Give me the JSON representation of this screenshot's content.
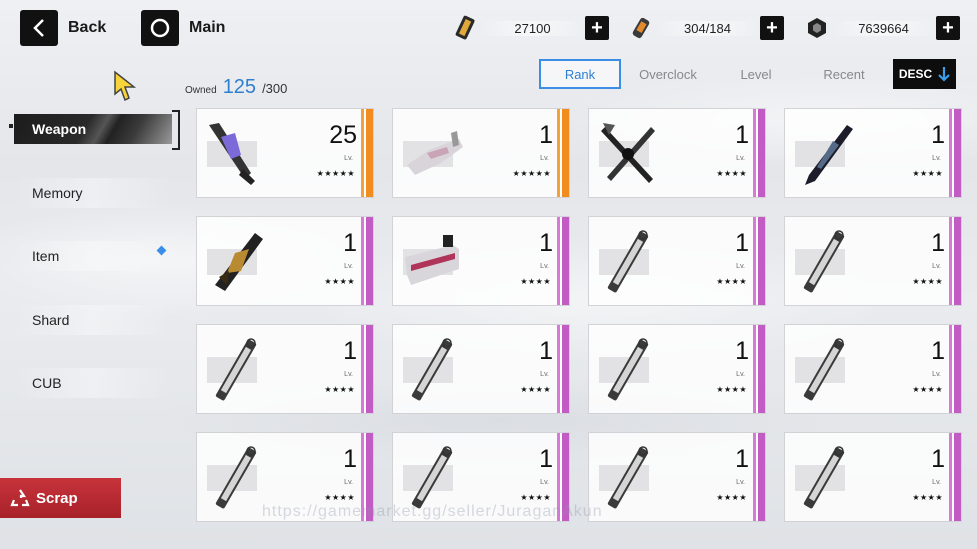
{
  "nav": {
    "back_label": "Back",
    "main_label": "Main"
  },
  "resources": [
    {
      "icon": "gold-ingot-icon",
      "value": "27100"
    },
    {
      "icon": "battery-icon",
      "value": "304/184"
    },
    {
      "icon": "gem-icon",
      "value": "7639664"
    }
  ],
  "sidebar": {
    "items": [
      {
        "label": "Weapon",
        "active": true
      },
      {
        "label": "Memory"
      },
      {
        "label": "Item",
        "notification": true
      },
      {
        "label": "Shard"
      },
      {
        "label": "CUB"
      }
    ],
    "scrap_label": "Scrap"
  },
  "inventory": {
    "owned_label": "Owned",
    "owned_count": "125",
    "owned_max": "/300"
  },
  "sort": {
    "tabs": [
      "Rank",
      "Overclock",
      "Level",
      "Recent"
    ],
    "active_tab": "Rank",
    "order_label": "DESC"
  },
  "weapons": [
    {
      "level": "25",
      "lv_label": "Lv.",
      "stars": "★★★★★",
      "rarity": 5,
      "art": "purple-blade"
    },
    {
      "level": "1",
      "lv_label": "Lv.",
      "stars": "★★★★★",
      "rarity": 5,
      "art": "white-gun"
    },
    {
      "level": "1",
      "lv_label": "Lv.",
      "stars": "★★★★",
      "rarity": 4,
      "art": "cross-blade"
    },
    {
      "level": "1",
      "lv_label": "Lv.",
      "stars": "★★★★",
      "rarity": 4,
      "art": "dark-sword"
    },
    {
      "level": "1",
      "lv_label": "Lv.",
      "stars": "★★★★",
      "rarity": 4,
      "art": "gold-claw"
    },
    {
      "level": "1",
      "lv_label": "Lv.",
      "stars": "★★★★",
      "rarity": 4,
      "art": "white-cannon"
    },
    {
      "level": "1",
      "lv_label": "Lv.",
      "stars": "★★★★",
      "rarity": 4,
      "art": "baton"
    },
    {
      "level": "1",
      "lv_label": "Lv.",
      "stars": "★★★★",
      "rarity": 4,
      "art": "baton"
    },
    {
      "level": "1",
      "lv_label": "Lv.",
      "stars": "★★★★",
      "rarity": 4,
      "art": "baton"
    },
    {
      "level": "1",
      "lv_label": "Lv.",
      "stars": "★★★★",
      "rarity": 4,
      "art": "baton"
    },
    {
      "level": "1",
      "lv_label": "Lv.",
      "stars": "★★★★",
      "rarity": 4,
      "art": "baton"
    },
    {
      "level": "1",
      "lv_label": "Lv.",
      "stars": "★★★★",
      "rarity": 4,
      "art": "baton"
    },
    {
      "level": "1",
      "lv_label": "Lv.",
      "stars": "★★★★",
      "rarity": 4,
      "art": "baton"
    },
    {
      "level": "1",
      "lv_label": "Lv.",
      "stars": "★★★★",
      "rarity": 4,
      "art": "baton"
    },
    {
      "level": "1",
      "lv_label": "Lv.",
      "stars": "★★★★",
      "rarity": 4,
      "art": "baton"
    },
    {
      "level": "1",
      "lv_label": "Lv.",
      "stars": "★★★★",
      "rarity": 4,
      "art": "baton"
    }
  ],
  "watermark": "https://gamemarket.gg/seller/JuraganAkun",
  "colors": {
    "accent": "#3a8ee6",
    "orange_rarity": "#f18c1f",
    "pink_rarity": "#c35bc4",
    "scrap": "#b8262e"
  }
}
